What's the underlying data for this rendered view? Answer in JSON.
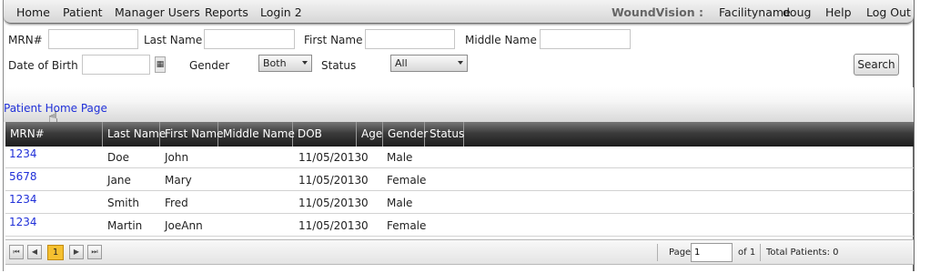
{
  "menu": {
    "items": [
      "Home",
      "Patient",
      "Manager Users",
      "Reports",
      "Login 2"
    ],
    "brand": "WoundVision :",
    "facility": "Facilityname",
    "user": "doug",
    "help": "Help",
    "logout": "Log Out"
  },
  "search": {
    "mrn_label": "MRN#",
    "mrn_value": "",
    "last_name_label": "Last Name",
    "last_name_value": "",
    "first_name_label": "First Name",
    "first_name_value": "",
    "middle_name_label": "Middle Name",
    "middle_name_value": "",
    "dob_label": "Date of Birth",
    "dob_value": "",
    "calendar_glyph": "▦",
    "gender_label": "Gender",
    "gender_selected": "Both",
    "status_label": "Status",
    "status_selected": "All",
    "search_button": "Search"
  },
  "breadcrumb": "Patient Home Page",
  "cursor_glyph": "☝",
  "grid": {
    "columns": [
      "MRN#",
      "Last Name",
      "First Name",
      "Middle Name",
      "DOB",
      "Age",
      "Gender",
      "Status"
    ],
    "rows": [
      {
        "mrn": "1234",
        "last": "Doe",
        "first": "John",
        "middle": "",
        "dob": "11/05/2013",
        "age": "0",
        "gender": "Male",
        "status": ""
      },
      {
        "mrn": "5678",
        "last": "Jane",
        "first": "Mary",
        "middle": "",
        "dob": "11/05/2013",
        "age": "0",
        "gender": "Female",
        "status": ""
      },
      {
        "mrn": "1234",
        "last": "Smith",
        "first": "Fred",
        "middle": "",
        "dob": "11/05/2013",
        "age": "0",
        "gender": "Male",
        "status": ""
      },
      {
        "mrn": "1234",
        "last": "Martin",
        "first": "JoeAnn",
        "middle": "",
        "dob": "11/05/2013",
        "age": "0",
        "gender": "Female",
        "status": ""
      }
    ]
  },
  "pager": {
    "first_glyph": "⏮",
    "prev_glyph": "◀",
    "current_page_button": "1",
    "next_glyph": "▶",
    "last_glyph": "⏭",
    "page_label": "Page",
    "page_value": "1",
    "of_label": "of 1",
    "total_label": "Total Patients: 0"
  },
  "colors": {
    "link": "#2030d8",
    "header_dark": "#1c1c1c",
    "current_page": "#f5c030"
  }
}
